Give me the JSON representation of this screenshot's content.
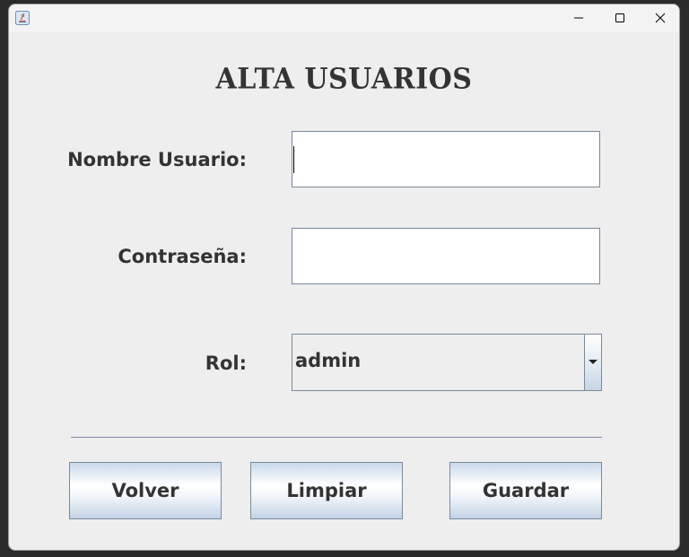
{
  "window": {
    "app_icon": "java-icon",
    "controls": {
      "minimize_icon": "minimize-icon",
      "maximize_icon": "maximize-icon",
      "close_icon": "close-icon"
    }
  },
  "form": {
    "title": "ALTA USUARIOS",
    "nombre_usuario": {
      "label": "Nombre Usuario:",
      "value": ""
    },
    "contrasena": {
      "label": "Contraseña:",
      "value": ""
    },
    "rol": {
      "label": "Rol:",
      "selected": "admin",
      "arrow_icon": "chevron-down-icon"
    }
  },
  "buttons": {
    "volver": "Volver",
    "limpiar": "Limpiar",
    "guardar": "Guardar"
  },
  "colors": {
    "background": "#eeeeee",
    "text": "#333333",
    "border": "#7a8a99",
    "separator": "#7a8aa8"
  }
}
